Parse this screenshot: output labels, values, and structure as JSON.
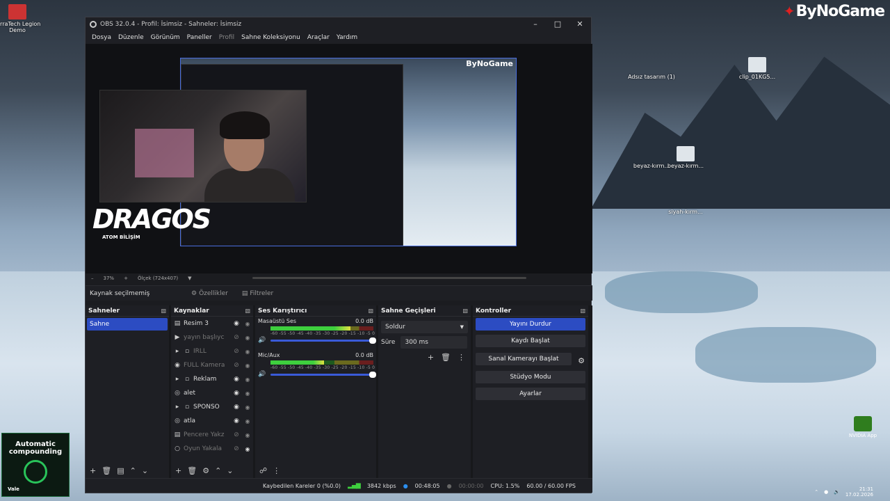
{
  "desktop": {
    "brand": "ByNoGame",
    "icons": [
      {
        "label": "TerraTech Legion Demo",
        "icon": "game-icon"
      },
      {
        "label": "Adsız tasarım (1)",
        "icon": "image-icon"
      },
      {
        "label": "clip_01KG5...",
        "icon": "video-icon"
      },
      {
        "label": "beyaz-kırm...",
        "icon": "image-icon"
      },
      {
        "label": "beyaz-kırm...",
        "icon": "image-icon"
      },
      {
        "label": "siyah-kırm...",
        "icon": "image-icon"
      },
      {
        "label": "NVIDIA App",
        "icon": "nvidia-icon"
      }
    ]
  },
  "window": {
    "title": "OBS 32.0.4 - Profil: İsimsiz - Sahneler: İsimsiz",
    "menu": [
      "Dosya",
      "Düzenle",
      "Görünüm",
      "Paneller",
      "Profil",
      "Sahne Koleksiyonu",
      "Araçlar",
      "Yardım"
    ]
  },
  "preview": {
    "overlay_brand": "ByNoGame",
    "camera_brand": "DRAGOS",
    "camera_sub": "ATOM BİLİŞİM",
    "zoom": "37%",
    "scale_label": "Ölçek (724x407)"
  },
  "context_bar": {
    "no_source": "Kaynak seçilmemiş",
    "properties": "Özellikler",
    "filters": "Filtreler"
  },
  "scenes": {
    "title": "Sahneler",
    "items": [
      "Sahne"
    ]
  },
  "sources": {
    "title": "Kaynaklar",
    "items": [
      {
        "icon": "image-icon",
        "name": "Resim 3",
        "visible": true
      },
      {
        "icon": "media-icon",
        "name": "yayın başlıyc",
        "visible": false
      },
      {
        "icon": "folder-icon",
        "name": "IRLL",
        "visible": false,
        "group": true
      },
      {
        "icon": "camera-icon",
        "name": "FULL Kamera",
        "visible": false
      },
      {
        "icon": "folder-icon",
        "name": "Reklam",
        "visible": true,
        "group": true
      },
      {
        "icon": "browser-icon",
        "name": "alet",
        "visible": true
      },
      {
        "icon": "folder-icon",
        "name": "SPONSO",
        "visible": true,
        "group": true
      },
      {
        "icon": "browser-icon",
        "name": "atla",
        "visible": true
      },
      {
        "icon": "window-icon",
        "name": "Pencere Yakz",
        "visible": false
      },
      {
        "icon": "gamepad-icon",
        "name": "Oyun Yakala",
        "visible": false
      }
    ]
  },
  "mixer": {
    "title": "Ses Karıştırıcı",
    "ticks": "-60 -55 -50 -45 -40 -35 -30 -25 -20 -15 -10 -5 0",
    "channels": [
      {
        "name": "Masaüstü Ses",
        "db": "0.0 dB",
        "level": 0.78
      },
      {
        "name": "Mic/Aux",
        "db": "0.0 dB",
        "level": 0.52
      }
    ]
  },
  "transitions": {
    "title": "Sahne Geçişleri",
    "selected": "Soldur",
    "duration_label": "Süre",
    "duration_value": "300 ms"
  },
  "controls": {
    "title": "Kontroller",
    "stop_stream": "Yayını Durdur",
    "start_recording": "Kaydı Başlat",
    "start_virtual_cam": "Sanal Kamerayı Başlat",
    "studio_mode": "Stüdyo Modu",
    "settings": "Ayarlar"
  },
  "status": {
    "dropped": "Kaybedilen Kareler 0 (%0.0)",
    "bitrate": "3842 kbps",
    "stream_time": "00:48:05",
    "record_time": "00:00:00",
    "cpu": "CPU: 1.5%",
    "fps": "60.00 / 60.00 FPS"
  },
  "promo": {
    "title": "Automatic compounding",
    "footer": "Vale"
  },
  "tray": {
    "time": "21:31",
    "date": "17.02.2026"
  },
  "colors": {
    "accent": "#2c4cc2",
    "meter_green": "#3ecf3e",
    "brand_red": "#e02020"
  }
}
